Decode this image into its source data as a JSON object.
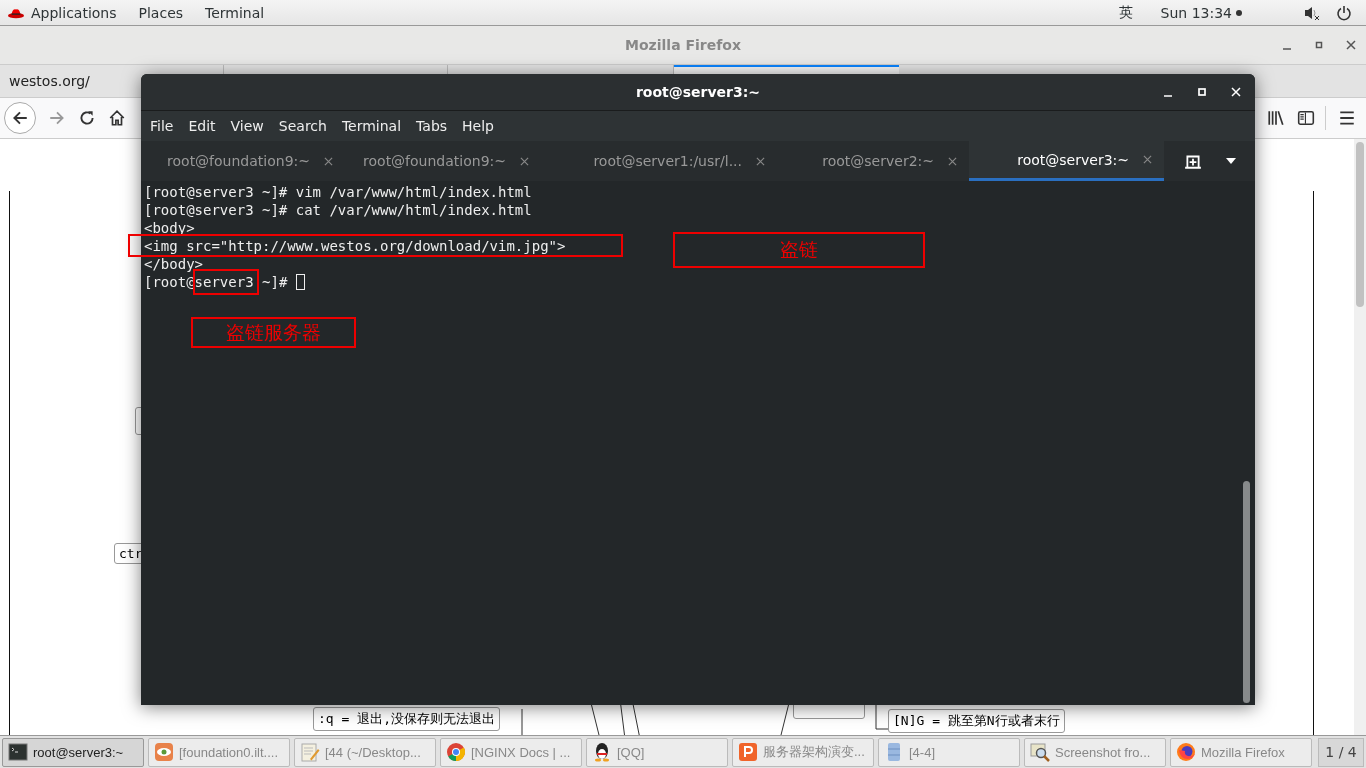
{
  "top_bar": {
    "menus": [
      "Applications",
      "Places",
      "Terminal"
    ],
    "input_method": "英",
    "clock": "Sun 13:34"
  },
  "firefox": {
    "title": "Mozilla Firefox",
    "tabs": [
      {
        "label": "westos.org/",
        "selected": false
      },
      {
        "selected": true
      }
    ],
    "page_nodes": [
      {
        "text": "ctr"
      },
      {
        "text": ":q = 退出,没保存则无法退出"
      },
      {
        "text": "[N]G = 跳至第N行或者末行"
      }
    ]
  },
  "terminal": {
    "title": "root@server3:~",
    "menus": [
      "File",
      "Edit",
      "View",
      "Search",
      "Terminal",
      "Tabs",
      "Help"
    ],
    "tabs": [
      {
        "label": "root@foundation9:~",
        "selected": false
      },
      {
        "label": "root@foundation9:~",
        "selected": false
      },
      {
        "label": "root@server1:/usr/l...",
        "selected": false
      },
      {
        "label": "root@server2:~",
        "selected": false
      },
      {
        "label": "root@server3:~",
        "selected": true
      }
    ],
    "lines": [
      {
        "text": "[root@server3 ~]# vim /var/www/html/index.html",
        "highlighted": false
      },
      {
        "text": "[root@server3 ~]# cat /var/www/html/index.html",
        "highlighted": false
      },
      {
        "text": "<body>",
        "highlighted": false
      },
      {
        "text": "<img src=\"http://www.westos.org/download/vim.jpg\">",
        "highlighted": true
      },
      {
        "text": "</body>",
        "highlighted": false
      }
    ],
    "prompt": [
      {
        "text": "[root@",
        "highlighted": false
      },
      {
        "text": "server3",
        "highlighted": true
      },
      {
        "text": " ~]#",
        "highlighted": false
      }
    ],
    "annotations": [
      "盗链",
      "盗链服务器"
    ]
  },
  "taskbar": {
    "items": [
      {
        "kind": "terminal",
        "label": "root@server3:~",
        "selected": true
      },
      {
        "kind": "eye",
        "label": "[foundation0.ilt....",
        "selected": false
      },
      {
        "kind": "notepad",
        "label": "[44 (~/Desktop...",
        "selected": false
      },
      {
        "kind": "chrome",
        "label": "[NGINX Docs | ...",
        "selected": false
      },
      {
        "kind": "penguin",
        "label": "[QQ]",
        "selected": false
      },
      {
        "kind": "slides",
        "label": "服务器架构演变...",
        "selected": false
      },
      {
        "kind": "file",
        "label": "[4-4]",
        "selected": false
      },
      {
        "kind": "screenshot",
        "label": "Screenshot fro...",
        "selected": false
      },
      {
        "kind": "firefox",
        "label": "Mozilla Firefox",
        "selected": false
      }
    ],
    "workspace": "1 / 4"
  }
}
